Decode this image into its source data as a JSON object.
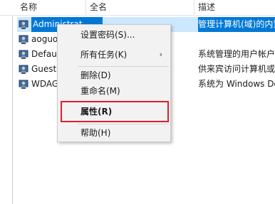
{
  "columns": {
    "name": "名称",
    "fullname": "全名",
    "description": "描述"
  },
  "rows": [
    {
      "name": "Administrat",
      "description": "管理计算机(域)的内置",
      "selected": true
    },
    {
      "name": "aoguo",
      "description": ""
    },
    {
      "name": "Defau",
      "description": "系统管理的用户帐户"
    },
    {
      "name": "Guest",
      "description": "供来宾访问计算机或"
    },
    {
      "name": "WDAG",
      "description": "系统为 Windows De"
    }
  ],
  "context_menu": {
    "items": [
      {
        "label": "设置密码(S)...",
        "submenu": false
      },
      {
        "label": "所有任务(K)",
        "submenu": true,
        "arrow": "›"
      },
      {
        "label": "删除(D)",
        "submenu": false
      },
      {
        "label": "重命名(M)",
        "submenu": false
      },
      {
        "label": "属性(R)",
        "submenu": false,
        "bold": true,
        "highlighted": true
      },
      {
        "label": "帮助(H)",
        "submenu": false
      }
    ]
  },
  "colors": {
    "selection": "#0078d7",
    "row_highlight": "#cce8ff",
    "menu_bg": "#f2f2f2",
    "annotation_box": "#e01e2b"
  }
}
